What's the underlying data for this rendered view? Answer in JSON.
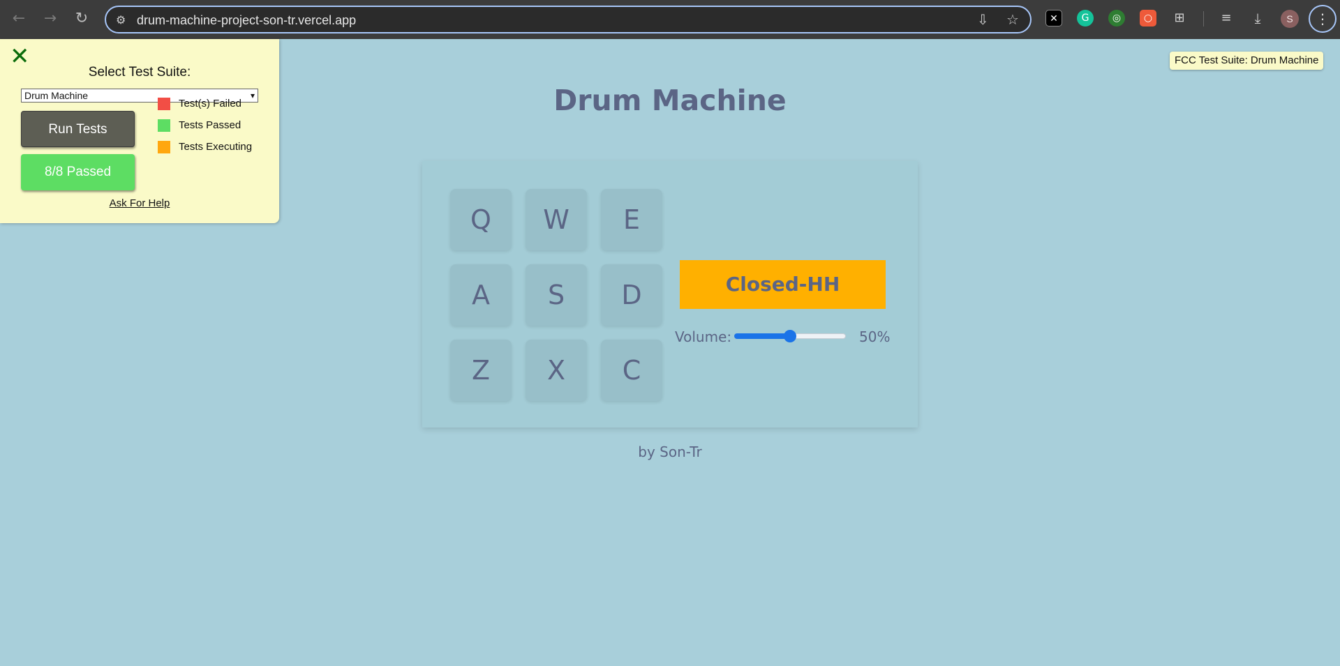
{
  "browser": {
    "url": "drum-machine-project-son-tr.vercel.app",
    "profile_initial": "S",
    "icons": {
      "back": "arrow-left-icon",
      "forward": "arrow-right-icon",
      "reload": "reload-icon",
      "site_info": "site-info-icon",
      "install": "install-app-icon",
      "bookmark": "star-icon",
      "extensions": [
        "x-extension-icon",
        "grammarly-icon",
        "target-extension-icon",
        "record-extension-icon",
        "puzzle-icon"
      ],
      "media": "media-control-icon",
      "downloads": "download-icon",
      "menu": "kebab-menu-icon"
    }
  },
  "fcc": {
    "close_icon": "close-x-icon",
    "title": "Select Test Suite:",
    "selected_suite": "Drum Machine",
    "run_tests_label": "Run Tests",
    "result_label": "8/8 Passed",
    "legend": [
      {
        "label": "Test(s) Failed",
        "color": "#f24e45"
      },
      {
        "label": "Tests Passed",
        "color": "#5ddd63"
      },
      {
        "label": "Tests Executing",
        "color": "#ffa70f"
      }
    ],
    "help_link": "Ask For Help",
    "tooltip": "FCC Test Suite: Drum Machine"
  },
  "app": {
    "title": "Drum Machine",
    "pads": [
      "Q",
      "W",
      "E",
      "A",
      "S",
      "D",
      "Z",
      "X",
      "C"
    ],
    "display": "Closed-HH",
    "volume_label": "Volume:",
    "volume_fraction": 0.5,
    "volume_value": "50%",
    "footer": "by Son-Tr",
    "colors": {
      "background": "#a8cfda",
      "text": "#5b6585",
      "display_bg": "#ffb000",
      "accent": "#1a73e8"
    }
  }
}
